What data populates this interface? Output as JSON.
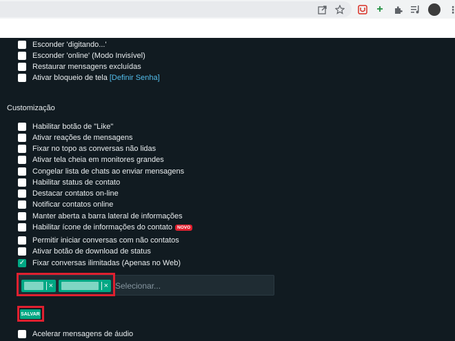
{
  "privacy_items": [
    {
      "label": "Esconder 'digitando...'",
      "checked": false
    },
    {
      "label": "Esconder 'online' (Modo Invisível)",
      "checked": false
    },
    {
      "label": "Restaurar mensagens excluídas",
      "checked": false
    },
    {
      "label": "Ativar bloqueio de tela",
      "checked": false,
      "link": "[Definir Senha]"
    }
  ],
  "customization": {
    "title": "Customização",
    "items": [
      {
        "label": "Habilitar botão de \"Like\"",
        "checked": false
      },
      {
        "label": "Ativar reações de mensagens",
        "checked": false
      },
      {
        "label": "Fixar no topo as conversas não lidas",
        "checked": false
      },
      {
        "label": "Ativar tela cheia em monitores grandes",
        "checked": false
      },
      {
        "label": "Congelar lista de chats ao enviar mensagens",
        "checked": false
      },
      {
        "label": "Habilitar status de contato",
        "checked": false
      },
      {
        "label": "Destacar contatos on-line",
        "checked": false
      },
      {
        "label": "Notificar contatos online",
        "checked": false
      },
      {
        "label": "Manter aberta a barra lateral de informações",
        "checked": false
      },
      {
        "label": "Habilitar ícone de informações do contato",
        "checked": false,
        "badge": "NOVO"
      },
      {
        "label": "Permitir iniciar conversas com não contatos",
        "checked": false
      },
      {
        "label": "Ativar botão de download de status",
        "checked": false
      },
      {
        "label": "Fixar conversas ilimitadas (Apenas no Web)",
        "checked": true
      }
    ]
  },
  "selector": {
    "placeholder": "Selecionar...",
    "remove_glyph": "×"
  },
  "save_label": "SALVAR",
  "audio_item": {
    "label": "Acelerar mensagens de áudio",
    "checked": false
  },
  "checkmark": "✓",
  "toolbar_icons": [
    "share-icon",
    "star-icon",
    "extension-red-icon",
    "extension-plus-icon",
    "puzzle-icon",
    "media-queue-icon",
    "avatar",
    "more-vert-icon"
  ],
  "colors": {
    "accent": "#00a884",
    "highlight": "#e0202f",
    "background": "#111b21",
    "link": "#53bdeb"
  }
}
